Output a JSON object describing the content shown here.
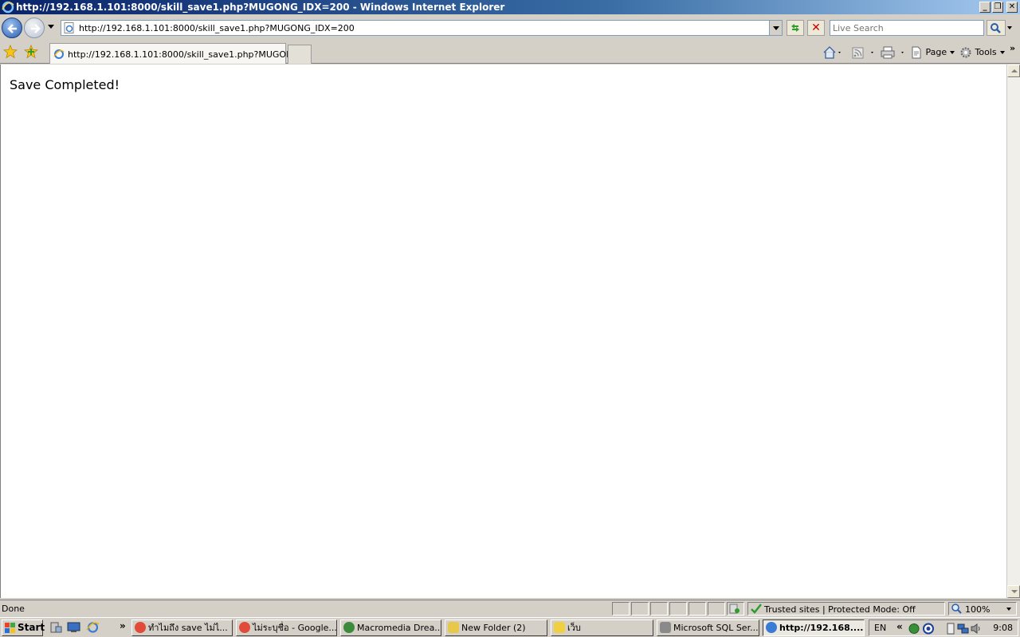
{
  "window": {
    "title": "http://192.168.1.101:8000/skill_save1.php?MUGONG_IDX=200 - Windows Internet Explorer"
  },
  "address_bar": {
    "url": "http://192.168.1.101:8000/skill_save1.php?MUGONG_IDX=200"
  },
  "search": {
    "placeholder": "Live Search"
  },
  "tabs": [
    {
      "label": "http://192.168.1.101:8000/skill_save1.php?MUGONG..."
    }
  ],
  "command_bar": {
    "page_label": "Page",
    "tools_label": "Tools"
  },
  "page": {
    "message": "Save Completed!"
  },
  "status_bar": {
    "status_text": "Done",
    "zone_text": "Trusted sites | Protected Mode: Off",
    "zoom_text": "100%"
  },
  "taskbar": {
    "start_label": "Start",
    "tasks": [
      {
        "label": "ทำไมถึง save ไม่ไ...",
        "icon": "chrome-icon",
        "color": "#e04b3a"
      },
      {
        "label": "ไม่ระบุชื่อ - Google...",
        "icon": "chrome-icon",
        "color": "#e04b3a"
      },
      {
        "label": "Macromedia Drea...",
        "icon": "dreamweaver-icon",
        "color": "#3c8a3c"
      },
      {
        "label": "New Folder (2)",
        "icon": "folder-icon",
        "color": "#e8c84a"
      },
      {
        "label": "เว็บ",
        "icon": "notepad-icon",
        "color": "#f0d040"
      },
      {
        "label": "Microsoft SQL Ser...",
        "icon": "sql-server-icon",
        "color": "#8a8a8a"
      },
      {
        "label": "http://192.168....",
        "icon": "ie-icon",
        "color": "#3a7bd5"
      }
    ],
    "language": "EN",
    "clock": "9:08"
  }
}
